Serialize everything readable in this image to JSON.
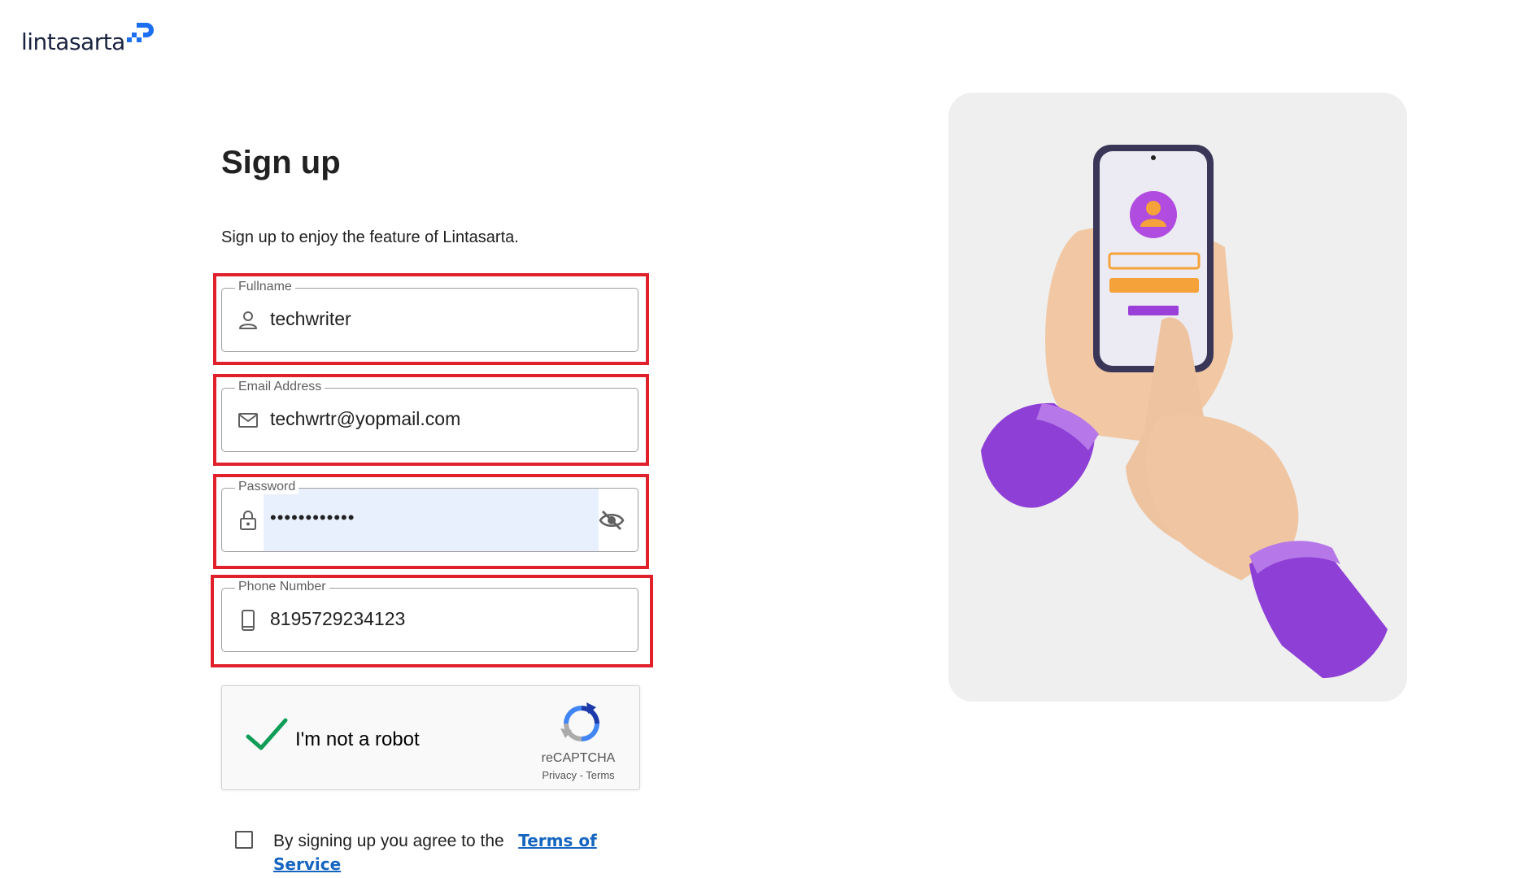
{
  "brand": {
    "name": "lintasarta",
    "accent": "#1d6ff2"
  },
  "page": {
    "title": "Sign up",
    "subtitle": "Sign up to enjoy the feature of Lintasarta."
  },
  "fields": {
    "fullname": {
      "label": "Fullname",
      "value": "techwriter",
      "icon": "person-icon"
    },
    "email": {
      "label": "Email Address",
      "value": "techwrtr@yopmail.com",
      "icon": "mail-icon"
    },
    "password": {
      "label": "Password",
      "value": "••••••••••••",
      "icon": "lock-icon",
      "toggle_icon": "eye-off-icon"
    },
    "phone": {
      "label": "Phone Number",
      "value": "8195729234123",
      "icon": "phone-icon"
    }
  },
  "captcha": {
    "label": "I'm not a robot",
    "checked": true,
    "brand": "reCAPTCHA",
    "privacy": "Privacy",
    "separator": " - ",
    "terms": "Terms"
  },
  "agreement": {
    "checked": false,
    "text": "By signing up you agree to the",
    "link": "Terms of Service"
  },
  "colors": {
    "highlight": "#e0202b",
    "check": "#0f9d58",
    "link": "#1565c0",
    "autofill": "#e8f0fe",
    "illustration_bg": "#efefef",
    "purple": "#8e3fd6"
  }
}
